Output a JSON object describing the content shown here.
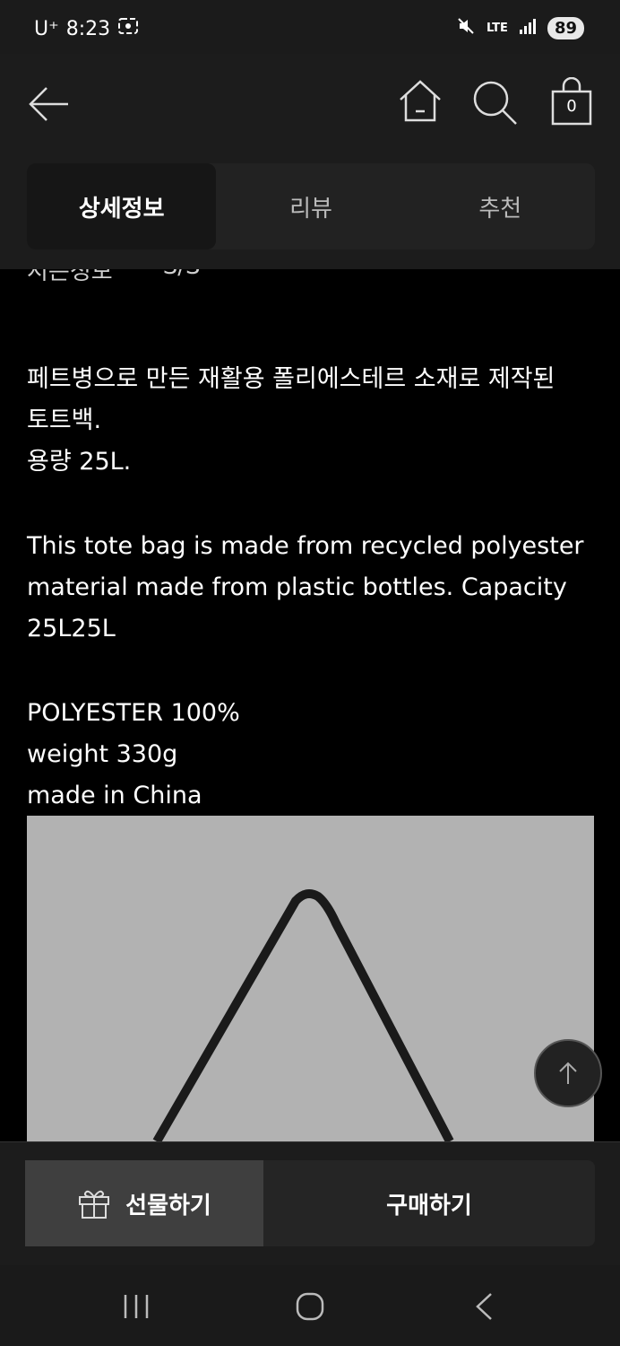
{
  "status_bar": {
    "carrier": "U⁺",
    "time": "8:23",
    "network": "LTE",
    "battery": "89"
  },
  "header": {
    "cart_count": "0"
  },
  "tabs": [
    {
      "label": "상세정보",
      "active": true
    },
    {
      "label": "리뷰",
      "active": false
    },
    {
      "label": "추천",
      "active": false
    }
  ],
  "content": {
    "cutoff_label": "시즌정보",
    "cutoff_value": "S/S",
    "description_ko": "페트병으로 만든 재활용 폴리에스테르 소재로 제작된\n토트백.\n용량 25L.",
    "description_en": "This tote bag is made from recycled polyester\nmaterial made from plastic bottles. Capacity\n25L25L",
    "specs": "POLYESTER 100%\nweight 330g\nmade in China"
  },
  "bottom_bar": {
    "gift_label": "선물하기",
    "buy_label": "구매하기"
  },
  "colors": {
    "background": "#000000",
    "header": "#1c1c1c",
    "image_bg": "#b2b2b2"
  }
}
